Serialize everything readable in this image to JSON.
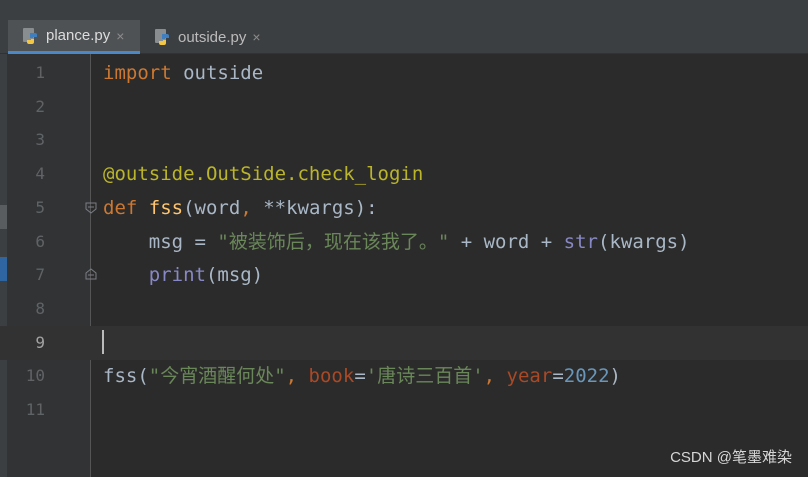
{
  "tabs": [
    {
      "label": "plance.py",
      "active": true,
      "icon": "python-file-icon",
      "close": "×"
    },
    {
      "label": "outside.py",
      "active": false,
      "icon": "python-file-icon",
      "close": "×"
    }
  ],
  "current_line": 9,
  "lines": [
    {
      "n": "1",
      "tokens": [
        {
          "t": "import",
          "c": "kw"
        },
        {
          "t": " outside",
          "c": ""
        }
      ]
    },
    {
      "n": "2",
      "tokens": []
    },
    {
      "n": "3",
      "tokens": []
    },
    {
      "n": "4",
      "tokens": [
        {
          "t": "@outside.OutSide.check_login",
          "c": "dec"
        }
      ]
    },
    {
      "n": "5",
      "tokens": [
        {
          "t": "def",
          "c": "kw"
        },
        {
          "t": " ",
          "c": ""
        },
        {
          "t": "fss",
          "c": "fn"
        },
        {
          "t": "(word",
          "c": ""
        },
        {
          "t": ",",
          "c": "kw"
        },
        {
          "t": " **kwargs):",
          "c": ""
        }
      ]
    },
    {
      "n": "6",
      "tokens": [
        {
          "t": "    msg = ",
          "c": ""
        },
        {
          "t": "\"被装饰后，现在该我了。\"",
          "c": "str"
        },
        {
          "t": " + word + ",
          "c": ""
        },
        {
          "t": "str",
          "c": "builtin"
        },
        {
          "t": "(kwargs)",
          "c": ""
        }
      ]
    },
    {
      "n": "7",
      "tokens": [
        {
          "t": "    ",
          "c": ""
        },
        {
          "t": "print",
          "c": "builtin"
        },
        {
          "t": "(msg)",
          "c": ""
        }
      ]
    },
    {
      "n": "8",
      "tokens": []
    },
    {
      "n": "9",
      "tokens": []
    },
    {
      "n": "10",
      "tokens": [
        {
          "t": "fss(",
          "c": ""
        },
        {
          "t": "\"今宵酒醒何处\"",
          "c": "str"
        },
        {
          "t": ", ",
          "c": "kw"
        },
        {
          "t": "book",
          "c": "kwarg"
        },
        {
          "t": "=",
          "c": ""
        },
        {
          "t": "'唐诗三百首'",
          "c": "str"
        },
        {
          "t": ", ",
          "c": "kw"
        },
        {
          "t": "year",
          "c": "kwarg"
        },
        {
          "t": "=",
          "c": ""
        },
        {
          "t": "2022",
          "c": "num"
        },
        {
          "t": ")",
          "c": ""
        }
      ]
    },
    {
      "n": "11",
      "tokens": []
    }
  ],
  "watermark": "CSDN @笔墨难染",
  "colors": {
    "background": "#2b2b2b",
    "keyword": "#cc7832",
    "decorator": "#bbb529",
    "function": "#ffc66d",
    "string": "#6a8759",
    "builtin": "#8888c6",
    "number": "#6897bb",
    "kwarg": "#aa4926",
    "text": "#a9b7c6",
    "tab_accent": "#4a88c7"
  }
}
